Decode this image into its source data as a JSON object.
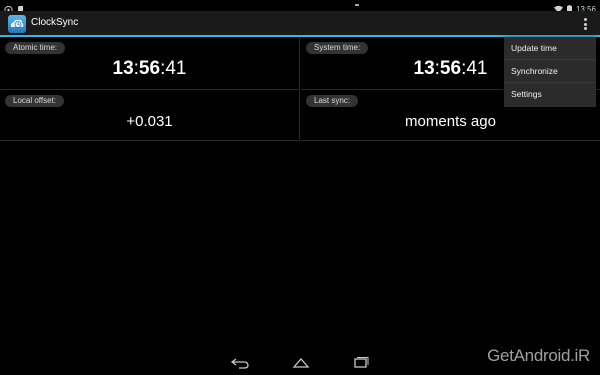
{
  "status_bar": {
    "time": "13:56",
    "left_icons": [
      "notification-icon",
      "sd-card-icon"
    ],
    "right_icons": [
      "wifi-icon",
      "battery-icon"
    ]
  },
  "app": {
    "title": "ClockSync",
    "icon": "clocksync-app-icon"
  },
  "cells": {
    "atomic": {
      "label": "Atomic time:",
      "hours": "13",
      "minutes": "56",
      "seconds": "41"
    },
    "system": {
      "label": "System time:",
      "hours": "13",
      "minutes": "56",
      "seconds": "41"
    },
    "offset": {
      "label": "Local offset:",
      "value": "+0.031"
    },
    "last_sync": {
      "label": "Last sync:",
      "value": "moments ago"
    }
  },
  "menu": {
    "items": [
      {
        "label": "Update time"
      },
      {
        "label": "Synchronize"
      },
      {
        "label": "Settings"
      }
    ]
  },
  "nav": {
    "buttons": [
      "back-icon",
      "home-icon",
      "recents-icon"
    ]
  },
  "watermark": "GetAndroid.iR",
  "colors": {
    "accent": "#33b5e5",
    "background": "#000000"
  }
}
